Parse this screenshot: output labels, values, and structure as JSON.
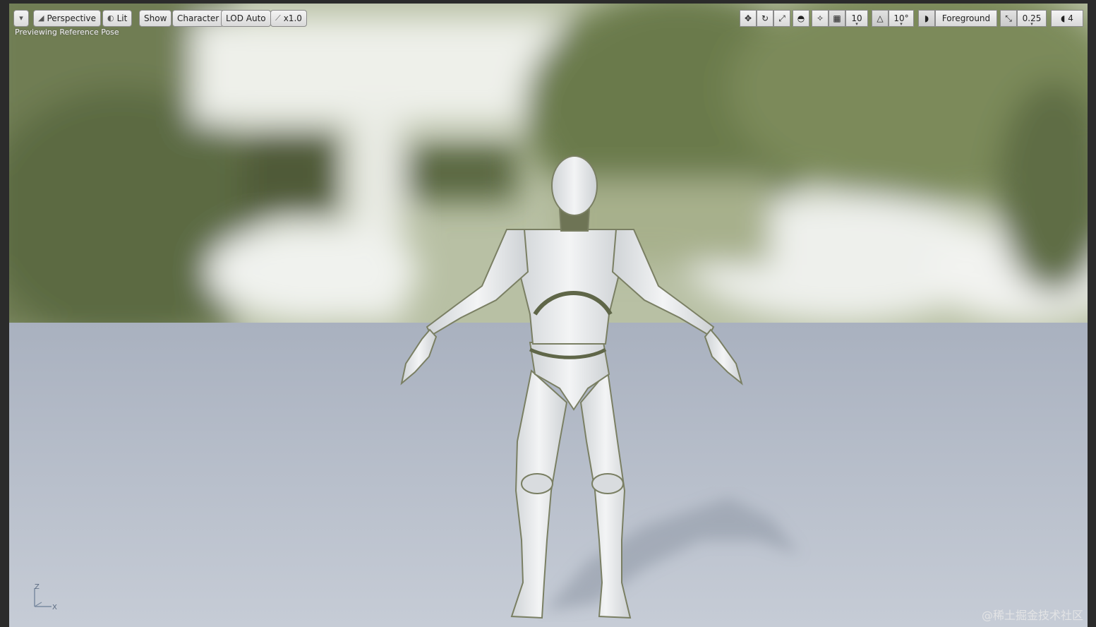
{
  "toolbar": {
    "menu_icon": "chevron-down-icon",
    "perspective_label": "Perspective",
    "lit_label": "Lit",
    "show_label": "Show",
    "character_label": "Character",
    "lod_label": "LOD Auto",
    "speed_label": "x1.0",
    "grid_snap_value": "10",
    "rotation_snap_value": "10°",
    "foreground_label": "Foreground",
    "scale_snap_value": "0.25",
    "camera_speed_value": "4"
  },
  "viewport": {
    "status_text": "Previewing Reference Pose",
    "axis_z": "Z",
    "axis_x": "X"
  },
  "watermark": "@稀土掘金技术社区",
  "colors": {
    "floor": "#b9c0cc",
    "sky_foliage": "#7d8a5c",
    "mannequin": "#e6e8ea"
  }
}
